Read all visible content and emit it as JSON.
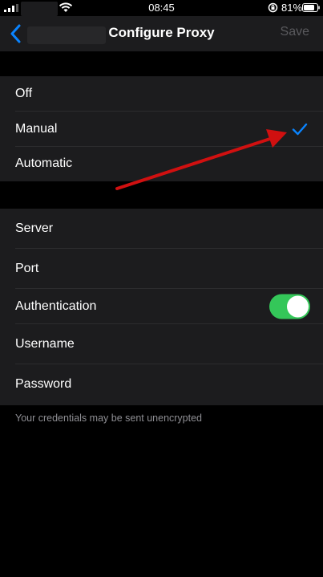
{
  "status_bar": {
    "time": "08:45",
    "battery": "81%"
  },
  "nav": {
    "title": "Configure Proxy",
    "save_label": "Save"
  },
  "proxy_mode": {
    "options": [
      {
        "label": "Off"
      },
      {
        "label": "Manual"
      },
      {
        "label": "Automatic"
      }
    ],
    "selected": "Manual"
  },
  "server_settings": {
    "server_label": "Server",
    "port_label": "Port",
    "authentication_label": "Authentication",
    "authentication_enabled": true,
    "username_label": "Username",
    "password_label": "Password"
  },
  "footer_note": "Your credentials may be sent unencrypted",
  "colors": {
    "accent": "#0a84ff",
    "toggle_on": "#34c759",
    "annotation_arrow": "#d01010",
    "background": "#000000",
    "cell": "#1c1c1e"
  }
}
